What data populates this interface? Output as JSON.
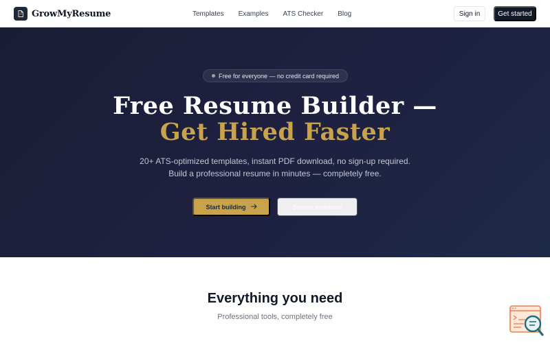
{
  "brand": {
    "name": "GrowMyResume",
    "icon": "document-icon"
  },
  "nav": {
    "links": [
      "Templates",
      "Examples",
      "ATS Checker",
      "Blog"
    ],
    "signin_label": "Sign in",
    "get_started_label": "Get started"
  },
  "hero": {
    "badge": "Free for everyone — no credit card required",
    "title_line1": "Free Resume Builder —",
    "title_line2": "Get Hired Faster",
    "subtitle_line1": "20+ ATS-optimized templates, instant PDF download, no sign-up required.",
    "subtitle_line2": "Build a professional resume in minutes — completely free.",
    "primary_cta": "Start building",
    "secondary_cta": "Browse templates"
  },
  "features": {
    "title": "Everything you need",
    "subtitle": "Professional tools, completely free"
  },
  "colors": {
    "hero_bg": "#1e2140",
    "accent_gold": "#c9a24c",
    "dark": "#111827",
    "widget_orange": "#e8804a",
    "widget_teal": "#1f6f7a"
  }
}
